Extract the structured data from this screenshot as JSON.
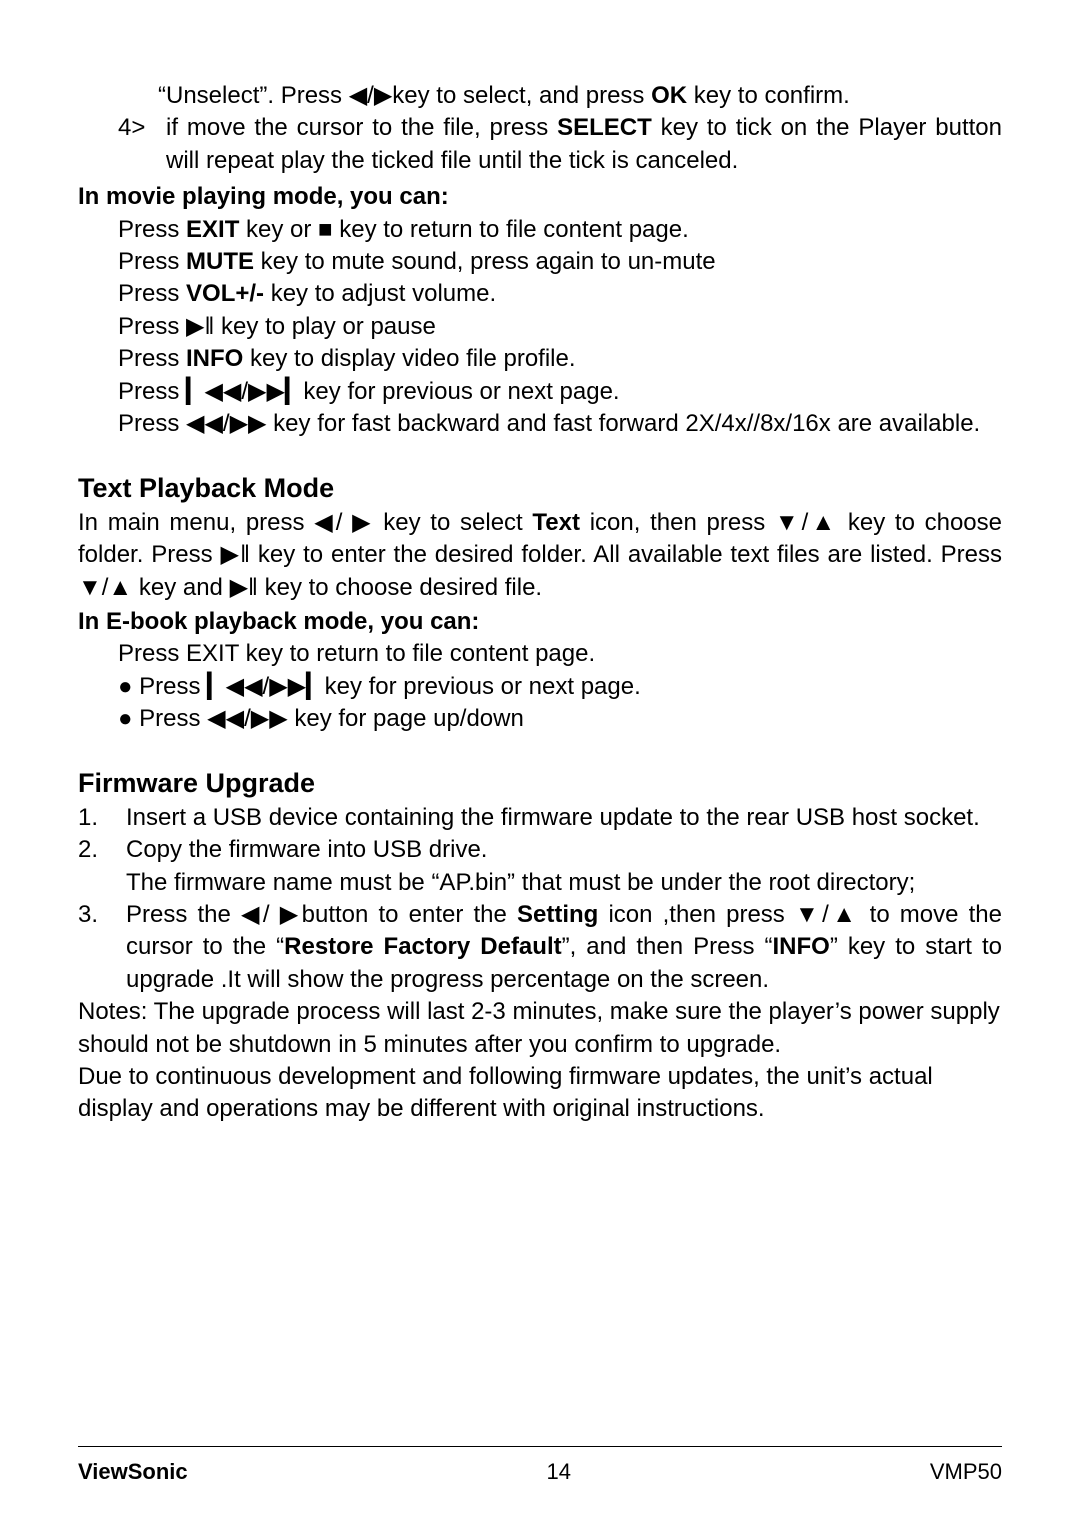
{
  "top": {
    "unselect_line": "“Unselect”. Press ◀/▶key to select, and press <b>OK</b> key to confirm.",
    "item4_num": "4>",
    "item4_body": "if move the cursor to the file, press <b>SELECT</b> key to tick on the Player button will repeat play the ticked file until the tick is canceled."
  },
  "movie": {
    "heading": "In movie playing mode, you can:",
    "lines": [
      "Press <b>EXIT</b> key or ■ key to return to file content page.",
      "Press <b>MUTE</b> key to mute sound, press again to un-mute",
      "Press <b>VOL+/-</b> key to adjust volume.",
      "Press ▶‖ key to play or pause",
      "Press <b>INFO</b> key to display video file profile.",
      "Press ▎◀◀/▶▶▎key for previous or next page.",
      "Press ◀◀/▶▶ key for fast backward and fast forward 2X/4x//8x/16x are available."
    ]
  },
  "textmode": {
    "title": "Text Playback Mode",
    "intro": "In main menu, press ◀/ ▶ key to select <b>Text</b> icon, then press ▼/▲ key to choose folder. Press ▶‖ key to enter the desired folder. All available text files are listed. Press ▼/▲ key and ▶‖ key to choose desired file.",
    "sub": "In E-book playback mode, you can:",
    "lines": [
      "Press EXIT key to return to file content page.",
      "● Press ▎◀◀/▶▶▎key for previous or next page.",
      "● Press ◀◀/▶▶ key for page up/down"
    ]
  },
  "firmware": {
    "title": "Firmware Upgrade",
    "items": [
      {
        "num": "1.",
        "body": "Insert a USB device containing the firmware update to the rear USB host socket."
      },
      {
        "num": "2.",
        "body": "Copy the firmware into USB drive.<br>The firmware name must be “AP.bin” that must be under the root directory;"
      },
      {
        "num": "3.",
        "body": "Press the ◀/ ▶button to enter the <b>Setting</b> icon ,then press ▼/▲ to move the cursor to the “<b>Restore Factory Default</b>”, and then Press “<b>INFO</b>” key to start to upgrade .It will show the progress percentage on the screen."
      }
    ],
    "notes1": "Notes: The upgrade process will last 2-3 minutes, make sure the player’s power supply should not be shutdown in 5 minutes after you confirm to upgrade.",
    "notes2": "Due to continuous development and following firmware updates, the unit’s actual display and operations may be different with original instructions."
  },
  "footer": {
    "left": "ViewSonic",
    "center": "14",
    "right": "VMP50"
  }
}
